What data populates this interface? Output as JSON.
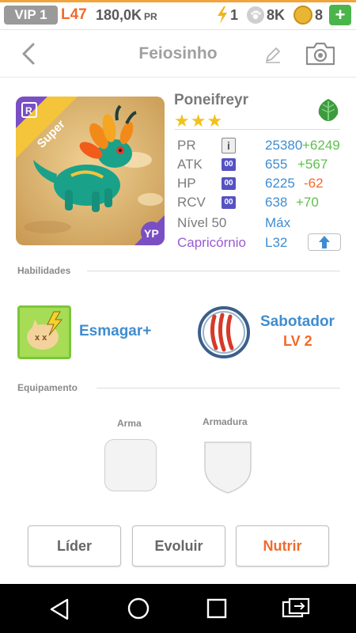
{
  "status": {
    "vip": "VIP 1",
    "level": "L47",
    "power": "180,0K",
    "power_unit": "PR",
    "energy": "1",
    "paws": "8K",
    "coins": "8",
    "add": "+"
  },
  "header": {
    "title": "Feiosinho"
  },
  "monster": {
    "rarity_badge": "Super",
    "rank_badge": "R",
    "corner_mark": "YP",
    "name": "Poneifreyr",
    "stars": "★★★",
    "element_icon": "leaf-icon"
  },
  "stats": {
    "pr": {
      "label": "PR",
      "badge": "i",
      "value": "25380",
      "bonus": "+6249"
    },
    "atk": {
      "label": "ATK",
      "badge": "00",
      "value": "655",
      "bonus": "+567"
    },
    "hp": {
      "label": "HP",
      "badge": "00",
      "value": "6225",
      "bonus": "-62"
    },
    "rcv": {
      "label": "RCV",
      "badge": "00",
      "value": "638",
      "bonus": "+70"
    },
    "level": {
      "label": "Nível 50",
      "value": "Máx"
    },
    "sign": {
      "label": "Capricórnio",
      "value": "L32"
    }
  },
  "skills": {
    "section_label": "Habilidades",
    "items": [
      {
        "name": "Esmagar+",
        "icon": "smash-icon"
      },
      {
        "name": "Sabotador",
        "level": "LV 2",
        "icon": "claw-icon"
      }
    ]
  },
  "equipment": {
    "section_label": "Equipamento",
    "weapon_label": "Arma",
    "armor_label": "Armadura"
  },
  "actions": {
    "leader": "Líder",
    "evolve": "Evoluir",
    "feed": "Nutrir"
  },
  "colors": {
    "accent_blue": "#3f8dd0",
    "accent_orange": "#f26a2a",
    "bonus_green": "#5fbf4f",
    "sign_purple": "#9a5bd3",
    "rarity_purple": "#7a4fc4",
    "plus_green": "#4bb54b"
  }
}
